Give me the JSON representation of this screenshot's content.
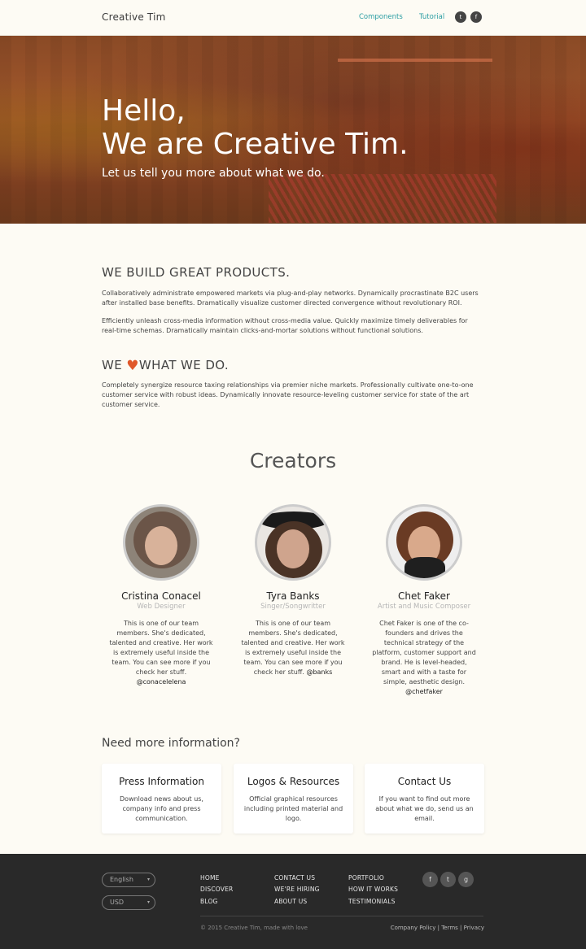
{
  "nav": {
    "brand": "Creative Tim",
    "links": [
      "Components",
      "Tutorial"
    ],
    "social": [
      {
        "icon": "twitter-icon",
        "glyph": "t"
      },
      {
        "icon": "facebook-icon",
        "glyph": "f"
      }
    ]
  },
  "hero": {
    "title_line1": "Hello,",
    "title_line2": "We are Creative Tim.",
    "subtitle": "Let us tell you more about what we do."
  },
  "about": {
    "heading1": "WE BUILD GREAT PRODUCTS.",
    "para1": "Collaboratively administrate empowered markets via plug-and-play networks. Dynamically procrastinate B2C users after installed base benefits. Dramatically visualize customer directed convergence without revolutionary ROI.",
    "para2": "Efficiently unleash cross-media information without cross-media value. Quickly maximize timely deliverables for real-time schemas. Dramatically maintain clicks-and-mortar solutions without functional solutions.",
    "heading2_pre": "WE",
    "heading2_post": "WHAT WE DO.",
    "para3": "Completely synergize resource taxing relationships via premier niche markets. Professionally cultivate one-to-one customer service with robust ideas. Dynamically innovate resource-leveling customer service for state of the art customer service."
  },
  "creators": {
    "title": "Creators",
    "people": [
      {
        "name": "Cristina Conacel",
        "role": "Web Designer",
        "bio": "This is one of our team members. She's dedicated, talented and creative. Her work is extremely useful inside the team. You can see more if you check her stuff.",
        "handle": "@conacelelena"
      },
      {
        "name": "Tyra Banks",
        "role": "Singer/Songwritter",
        "bio": "This is one of our team members. She's dedicated, talented and creative. Her work is extremely useful inside the team. You can see more if you check her stuff.",
        "handle": "@banks"
      },
      {
        "name": "Chet Faker",
        "role": "Artist and Music Composer",
        "bio": "Chet Faker is one of the co-founders and drives the technical strategy of the platform, customer support and brand. He is level-headed, smart and with a taste for simple, aesthetic design.",
        "handle": "@chetfaker"
      }
    ]
  },
  "info": {
    "heading": "Need more information?",
    "boxes": [
      {
        "title": "Press Information",
        "desc": "Download news about us, company info and press communication."
      },
      {
        "title": "Logos & Resources",
        "desc": "Official graphical resources including printed material and logo."
      },
      {
        "title": "Contact Us",
        "desc": "If you want to find out more about what we do, send us an email."
      }
    ]
  },
  "footer": {
    "language": "English",
    "currency": "USD",
    "col1": [
      "HOME",
      "DISCOVER",
      "BLOG"
    ],
    "col2": [
      "CONTACT US",
      "WE'RE HIRING",
      "ABOUT US"
    ],
    "col3": [
      "PORTFOLIO",
      "HOW IT WORKS",
      "TESTIMONIALS"
    ],
    "social": [
      {
        "icon": "facebook-icon",
        "glyph": "f"
      },
      {
        "icon": "twitter-icon",
        "glyph": "t"
      },
      {
        "icon": "google-plus-icon",
        "glyph": "g"
      }
    ],
    "copyright": "© 2015 Creative Tim, made with love",
    "legal": [
      "Company Policy",
      "Terms",
      "Privacy"
    ],
    "legal_sep": "|"
  },
  "colors": {
    "accent": "#2a9da3",
    "heart": "#e0582a",
    "footer_bg": "#292929"
  }
}
